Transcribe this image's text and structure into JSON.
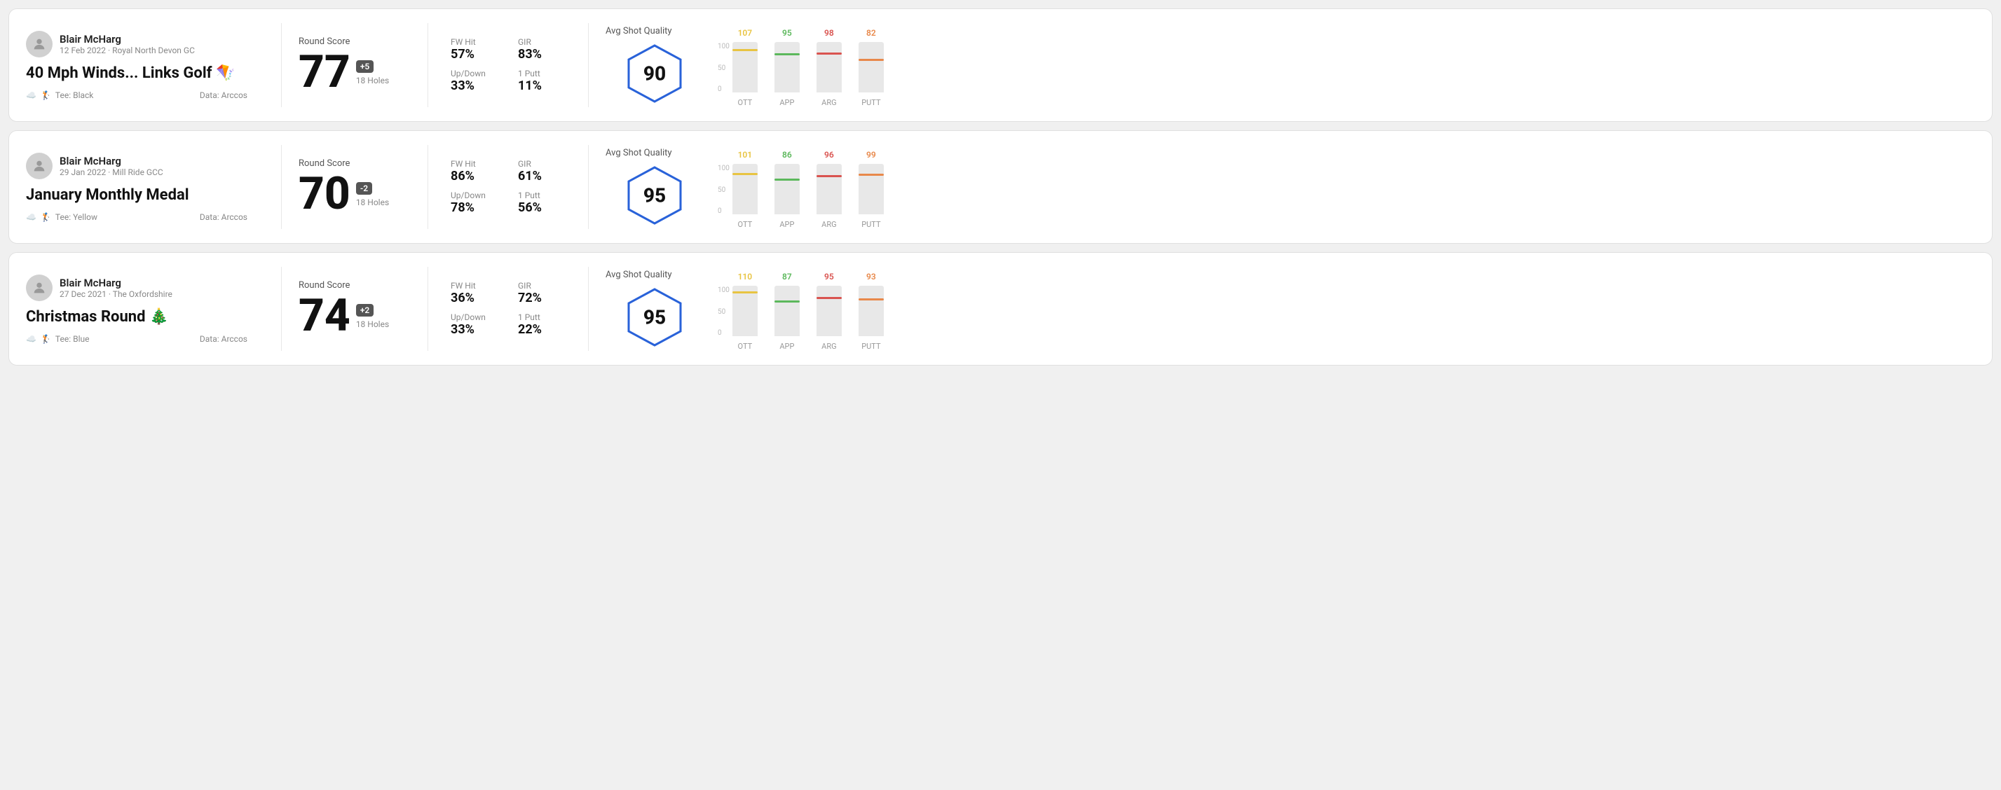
{
  "rounds": [
    {
      "id": "round-1",
      "player": {
        "name": "Blair McHarg",
        "date": "12 Feb 2022 · Royal North Devon GC"
      },
      "title": "40 Mph Winds... Links Golf 🪁",
      "tee": "Black",
      "data_source": "Data: Arccos",
      "score": {
        "label": "Round Score",
        "number": "77",
        "badge": "+5",
        "holes": "18 Holes"
      },
      "stats": [
        {
          "label": "FW Hit",
          "value": "57%"
        },
        {
          "label": "GIR",
          "value": "83%"
        },
        {
          "label": "Up/Down",
          "value": "33%"
        },
        {
          "label": "1 Putt",
          "value": "11%"
        }
      ],
      "quality": {
        "label": "Avg Shot Quality",
        "score": "90"
      },
      "chart": {
        "bars": [
          {
            "label": "OTT",
            "value": 107,
            "color": "#e8c442"
          },
          {
            "label": "APP",
            "value": 95,
            "color": "#5cb85c"
          },
          {
            "label": "ARG",
            "value": 98,
            "color": "#d9534f"
          },
          {
            "label": "PUTT",
            "value": 82,
            "color": "#e8884a"
          }
        ]
      }
    },
    {
      "id": "round-2",
      "player": {
        "name": "Blair McHarg",
        "date": "29 Jan 2022 · Mill Ride GCC"
      },
      "title": "January Monthly Medal",
      "tee": "Yellow",
      "data_source": "Data: Arccos",
      "score": {
        "label": "Round Score",
        "number": "70",
        "badge": "-2",
        "holes": "18 Holes"
      },
      "stats": [
        {
          "label": "FW Hit",
          "value": "86%"
        },
        {
          "label": "GIR",
          "value": "61%"
        },
        {
          "label": "Up/Down",
          "value": "78%"
        },
        {
          "label": "1 Putt",
          "value": "56%"
        }
      ],
      "quality": {
        "label": "Avg Shot Quality",
        "score": "95"
      },
      "chart": {
        "bars": [
          {
            "label": "OTT",
            "value": 101,
            "color": "#e8c442"
          },
          {
            "label": "APP",
            "value": 86,
            "color": "#5cb85c"
          },
          {
            "label": "ARG",
            "value": 96,
            "color": "#d9534f"
          },
          {
            "label": "PUTT",
            "value": 99,
            "color": "#e8884a"
          }
        ]
      }
    },
    {
      "id": "round-3",
      "player": {
        "name": "Blair McHarg",
        "date": "27 Dec 2021 · The Oxfordshire"
      },
      "title": "Christmas Round 🎄",
      "tee": "Blue",
      "data_source": "Data: Arccos",
      "score": {
        "label": "Round Score",
        "number": "74",
        "badge": "+2",
        "holes": "18 Holes"
      },
      "stats": [
        {
          "label": "FW Hit",
          "value": "36%"
        },
        {
          "label": "GIR",
          "value": "72%"
        },
        {
          "label": "Up/Down",
          "value": "33%"
        },
        {
          "label": "1 Putt",
          "value": "22%"
        }
      ],
      "quality": {
        "label": "Avg Shot Quality",
        "score": "95"
      },
      "chart": {
        "bars": [
          {
            "label": "OTT",
            "value": 110,
            "color": "#e8c442"
          },
          {
            "label": "APP",
            "value": 87,
            "color": "#5cb85c"
          },
          {
            "label": "ARG",
            "value": 95,
            "color": "#d9534f"
          },
          {
            "label": "PUTT",
            "value": 93,
            "color": "#e8884a"
          }
        ]
      }
    }
  ],
  "chart_y_labels": [
    "100",
    "50",
    "0"
  ]
}
